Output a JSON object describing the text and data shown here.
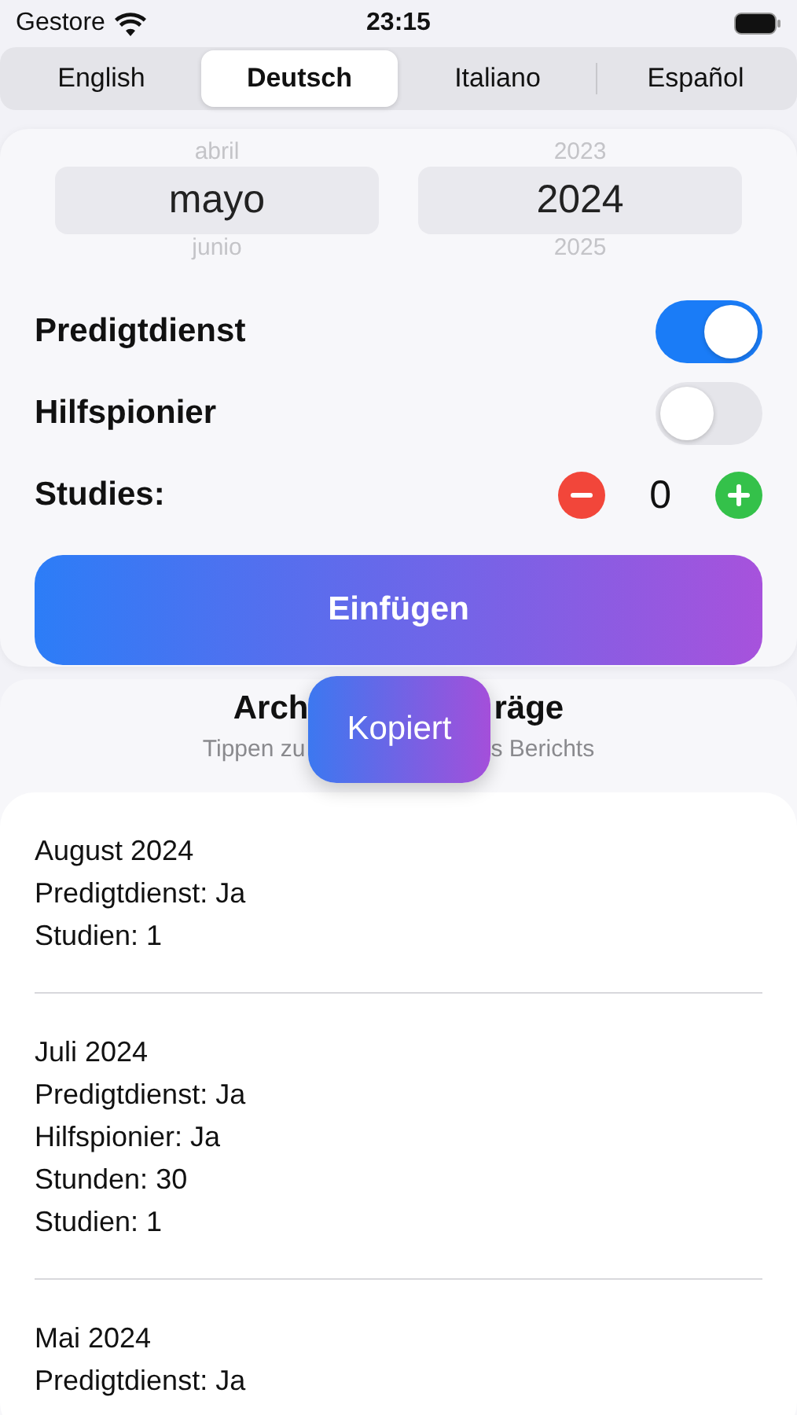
{
  "status_bar": {
    "carrier": "Gestore",
    "time": "23:15"
  },
  "languages": [
    {
      "label": "English",
      "selected": false
    },
    {
      "label": "Deutsch",
      "selected": true
    },
    {
      "label": "Italiano",
      "selected": false
    },
    {
      "label": "Español",
      "selected": false
    }
  ],
  "picker": {
    "month": {
      "above": "abril",
      "value": "mayo",
      "below": "junio"
    },
    "year": {
      "above": "2023",
      "value": "2024",
      "below": "2025"
    }
  },
  "toggles": [
    {
      "label": "Predigtdienst",
      "on": true
    },
    {
      "label": "Hilfspionier",
      "on": false
    }
  ],
  "studies": {
    "label": "Studies:",
    "value": "0"
  },
  "insert_button": "Einfügen",
  "archive": {
    "title_parts": [
      "Arch",
      "räge"
    ],
    "subtitle_parts": [
      "Tippen zu",
      "s Berichts"
    ],
    "entries": [
      {
        "lines": [
          "August 2024",
          "Predigtdienst: Ja",
          "Studien: 1"
        ]
      },
      {
        "lines": [
          "Juli 2024",
          "Predigtdienst: Ja",
          "Hilfspionier: Ja",
          "Stunden: 30",
          "Studien: 1"
        ]
      },
      {
        "lines": [
          "Mai 2024",
          "Predigtdienst: Ja"
        ]
      }
    ]
  },
  "toast": "Kopiert"
}
